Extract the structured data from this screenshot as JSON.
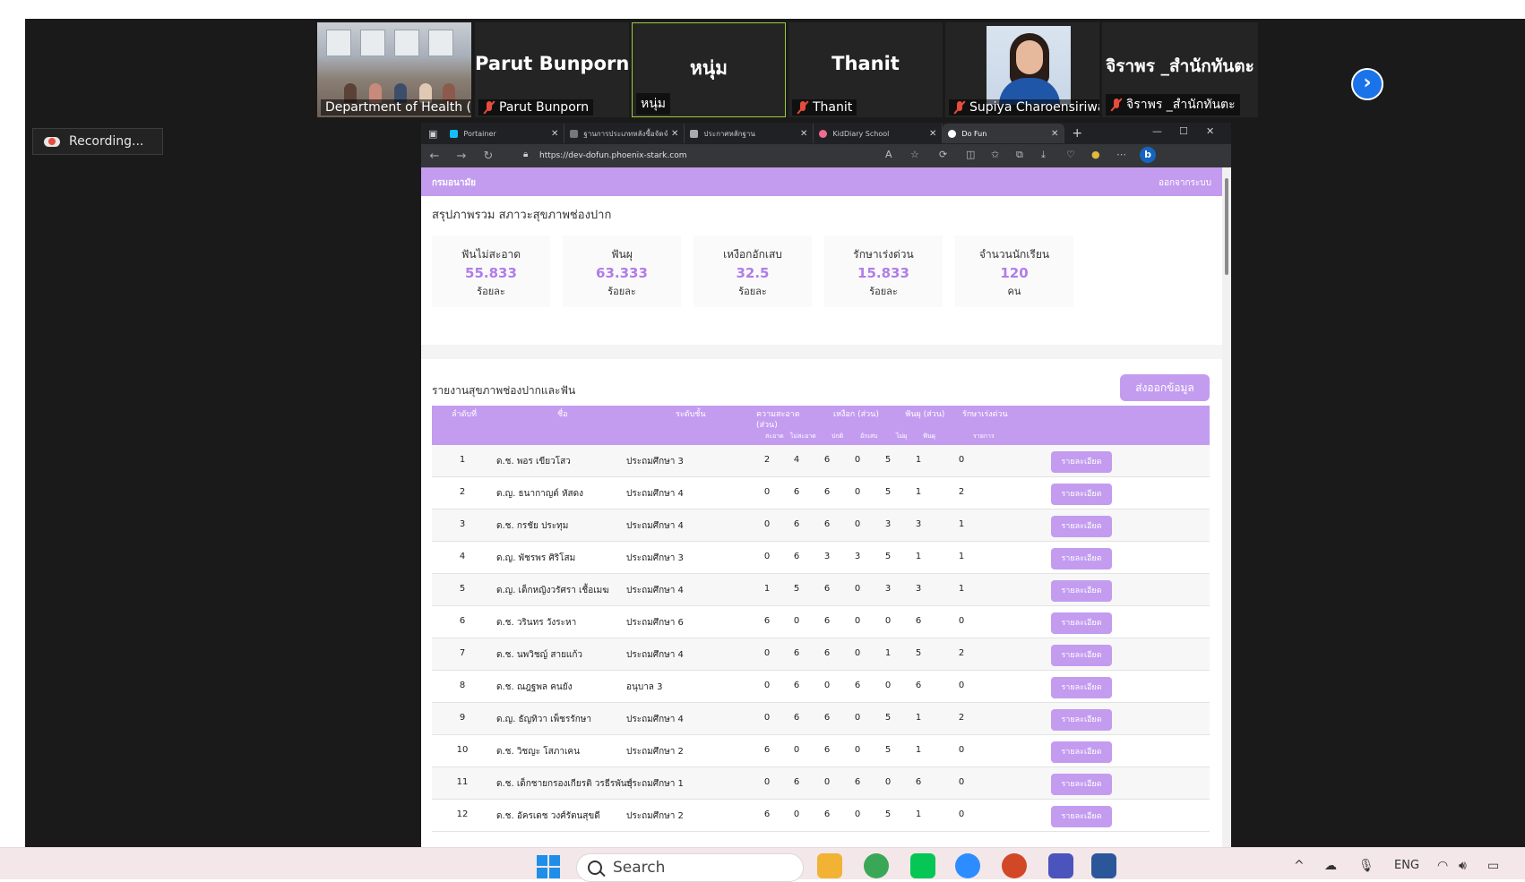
{
  "zoom": {
    "participants": [
      {
        "name": "Department of Health (Th...",
        "type": "video-room"
      },
      {
        "name": "Parut Bunporn",
        "type": "name",
        "muted": true
      },
      {
        "name": "หนุ่ม",
        "type": "name",
        "active": true
      },
      {
        "name": "Thanit",
        "type": "name",
        "muted": true
      },
      {
        "name": "Supiya Charoensiriwath",
        "type": "video-face",
        "muted": true
      },
      {
        "name": "จิราพร _สำนักทันตะ",
        "type": "name",
        "muted": true
      }
    ],
    "recording_label": "Recording...",
    "next_icon": "chevron-right-icon"
  },
  "browser": {
    "tabs": [
      {
        "title": "Portainer",
        "favicon_color": "#13bef9"
      },
      {
        "title": "ฐานการประเภทหลังซื้อจัดจำหน่ย",
        "favicon_color": "#777777"
      },
      {
        "title": "ประกาศหลักฐาน",
        "favicon_color": "#aaaaaa"
      },
      {
        "title": "KidDiary School",
        "favicon_color": "#f06c8c"
      },
      {
        "title": "Do Fun",
        "favicon_color": "#ffffff",
        "active": true
      }
    ],
    "url": "https://dev-dofun.phoenix-stark.com",
    "new_tab": "+",
    "min": "—",
    "max": "☐",
    "close": "✕"
  },
  "page": {
    "brand": "กรมอนามัย",
    "logout": "ออกจากระบบ",
    "summary_title": "สรุปภาพรวม สภาวะสุขภาพช่องปาก",
    "stats": [
      {
        "label": "ฟันไม่สะอาด",
        "value": "55.833",
        "unit": "ร้อยละ"
      },
      {
        "label": "ฟันผุ",
        "value": "63.333",
        "unit": "ร้อยละ"
      },
      {
        "label": "เหงือกอักเสบ",
        "value": "32.5",
        "unit": "ร้อยละ"
      },
      {
        "label": "รักษาเร่งด่วน",
        "value": "15.833",
        "unit": "ร้อยละ"
      },
      {
        "label": "จำนวนนักเรียน",
        "value": "120",
        "unit": "คน"
      }
    ],
    "report_title": "รายงานสุขภาพช่องปากและฟัน",
    "export_label": "ส่งออกข้อมูล",
    "detail_label": "รายละเอียด",
    "headers": {
      "no": "ลำดับที่",
      "name": "ชื่อ",
      "level": "ระดับชั้น",
      "clean_1": "ความสะอาด",
      "clean_2": "(ส่วน)",
      "gum": "เหงือก (ส่วน)",
      "decay": "ฟันผุ (ส่วน)",
      "urgent": "รักษาเร่งด่วน",
      "sub_clean": "สะอาด",
      "sub_notclean": "ไม่สะอาด",
      "sub_normal": "ปกติ",
      "sub_inflamed": "อักเสบ",
      "sub_nodecay": "ไม่ผุ",
      "sub_decay": "ฟันผุ",
      "sub_items": "รายการ"
    },
    "rows": [
      {
        "no": "1",
        "name": "ด.ช. พอร เขียวโสว",
        "level": "ประถมศึกษา 3",
        "v": [
          "2",
          "4",
          "6",
          "0",
          "5",
          "1",
          "0"
        ]
      },
      {
        "no": "2",
        "name": "ด.ญ. ธนากาญต์ หัสดง",
        "level": "ประถมศึกษา 4",
        "v": [
          "0",
          "6",
          "6",
          "0",
          "5",
          "1",
          "2"
        ]
      },
      {
        "no": "3",
        "name": "ด.ช. กรชัย ประทุม",
        "level": "ประถมศึกษา 4",
        "v": [
          "0",
          "6",
          "6",
          "0",
          "3",
          "3",
          "1"
        ]
      },
      {
        "no": "4",
        "name": "ด.ญ. พัชรพร ศิริโสม",
        "level": "ประถมศึกษา 3",
        "v": [
          "0",
          "6",
          "3",
          "3",
          "5",
          "1",
          "1"
        ]
      },
      {
        "no": "5",
        "name": "ด.ญ. เด็กหญิงวรัศรา เชื้อเมฆ",
        "level": "ประถมศึกษา 4",
        "v": [
          "1",
          "5",
          "6",
          "0",
          "3",
          "3",
          "1"
        ]
      },
      {
        "no": "6",
        "name": "ด.ช. วรินทร วังระหา",
        "level": "ประถมศึกษา 6",
        "v": [
          "6",
          "0",
          "6",
          "0",
          "0",
          "6",
          "0"
        ]
      },
      {
        "no": "7",
        "name": "ด.ช. นพวิชญ์ สายแก้ว",
        "level": "ประถมศึกษา 4",
        "v": [
          "0",
          "6",
          "6",
          "0",
          "1",
          "5",
          "2"
        ]
      },
      {
        "no": "8",
        "name": "ด.ช. ณฎฐพล คนยัง",
        "level": "อนุบาล 3",
        "v": [
          "0",
          "6",
          "0",
          "6",
          "0",
          "6",
          "0"
        ]
      },
      {
        "no": "9",
        "name": "ด.ญ. ธัญทิวา เพ็ชรรักษา",
        "level": "ประถมศึกษา 4",
        "v": [
          "0",
          "6",
          "6",
          "0",
          "5",
          "1",
          "2"
        ]
      },
      {
        "no": "10",
        "name": "ด.ช. วิชญะ โสภาเคน",
        "level": "ประถมศึกษา 2",
        "v": [
          "6",
          "0",
          "6",
          "0",
          "5",
          "1",
          "0"
        ]
      },
      {
        "no": "11",
        "name": "ด.ช. เด็กชายกรองเกียรติ วรธีรพันธุ์",
        "level": "ประถมศึกษา 1",
        "v": [
          "0",
          "6",
          "0",
          "6",
          "0",
          "6",
          "0"
        ]
      },
      {
        "no": "12",
        "name": "ด.ช. อัครเดช วงศ์รัตนสุขดี",
        "level": "ประถมศึกษา 2",
        "v": [
          "6",
          "0",
          "6",
          "0",
          "5",
          "1",
          "0"
        ]
      }
    ]
  },
  "taskbar": {
    "search_placeholder": "Search",
    "language": "ENG",
    "apps": [
      {
        "name": "file-explorer",
        "color": "#f2b233"
      },
      {
        "name": "chrome",
        "color": "#3aa757"
      },
      {
        "name": "line",
        "color": "#06c755"
      },
      {
        "name": "zoom",
        "color": "#2d8cff"
      },
      {
        "name": "powerpoint",
        "color": "#d24726"
      },
      {
        "name": "teams",
        "color": "#4b53bc"
      },
      {
        "name": "word",
        "color": "#2b579a"
      }
    ]
  }
}
